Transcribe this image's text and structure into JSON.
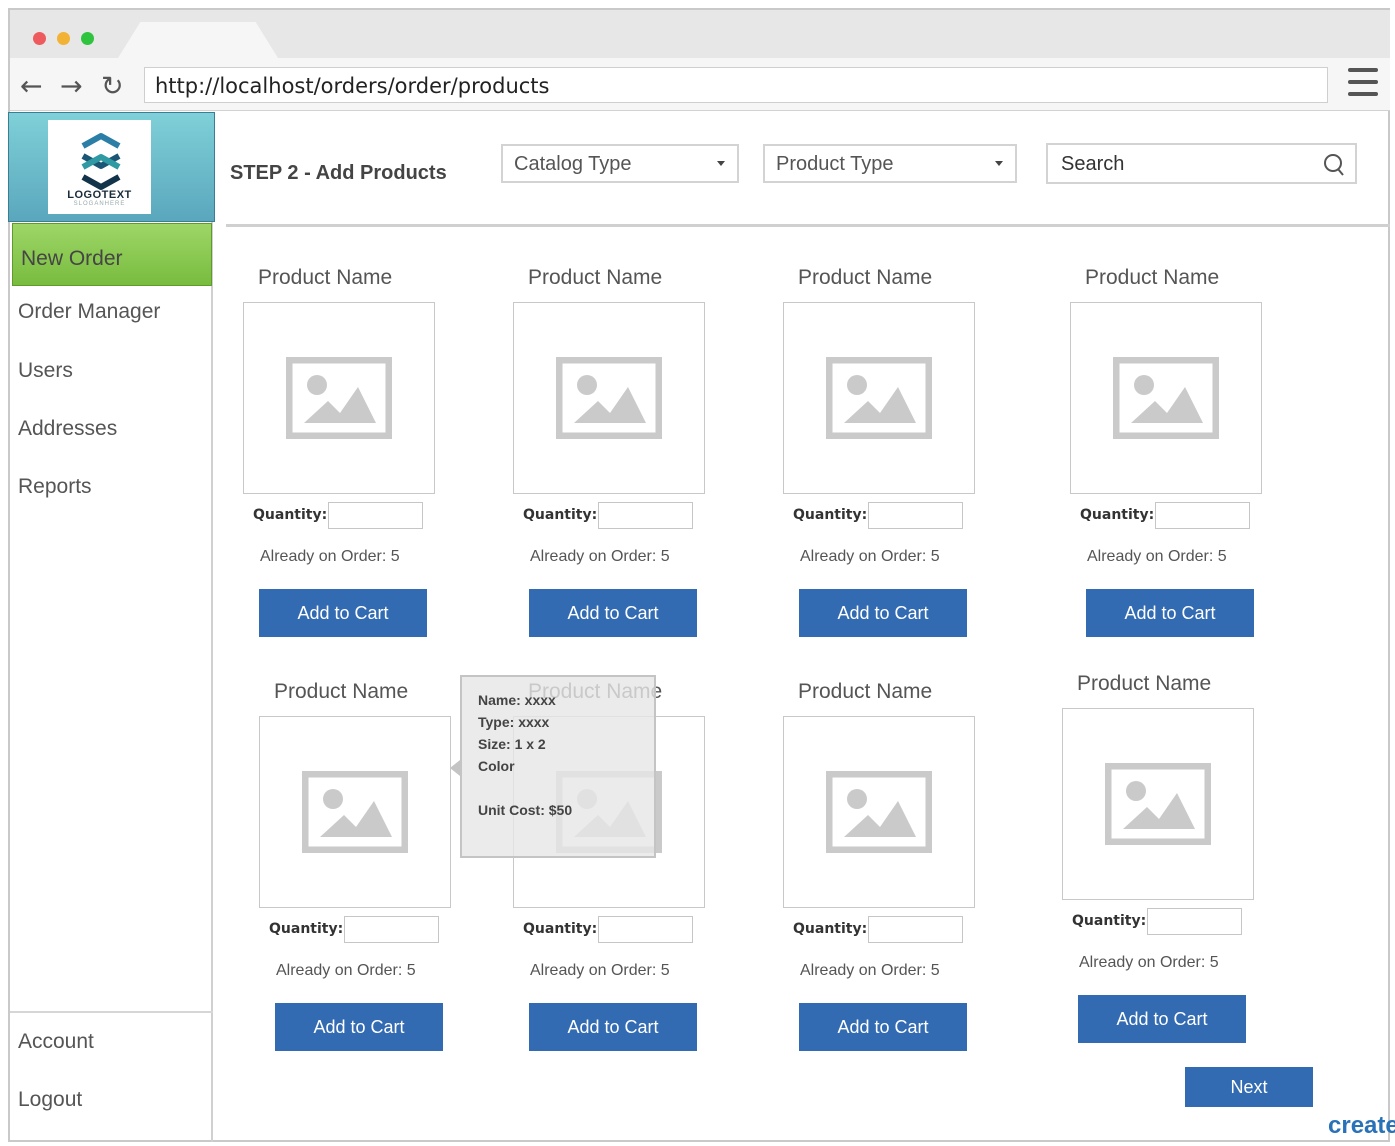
{
  "browser": {
    "url": "http://localhost/orders/order/products",
    "dot_colors": [
      "#ee5b5e",
      "#f2b233",
      "#2fc43e"
    ]
  },
  "logo": {
    "text": "LOGOTEXT",
    "slogan": "SLOGANHERE"
  },
  "sidebar": {
    "items": [
      {
        "label": "New Order",
        "active": true
      },
      {
        "label": "Order Manager"
      },
      {
        "label": "Users"
      },
      {
        "label": "Addresses"
      },
      {
        "label": "Reports"
      }
    ],
    "bottom_items": [
      {
        "label": "Account"
      },
      {
        "label": "Logout"
      }
    ]
  },
  "header": {
    "title": "STEP 2 - Add Products",
    "catalog_type": "Catalog Type",
    "product_type": "Product Type",
    "search_placeholder": "Search"
  },
  "products": [
    {
      "name": "Product Name",
      "quantity_label": "Quantity:",
      "already_label": "Already on Order:",
      "already_value": "5",
      "button": "Add to Cart"
    },
    {
      "name": "Product Name",
      "quantity_label": "Quantity:",
      "already_label": "Already on Order:",
      "already_value": "5",
      "button": "Add to Cart"
    },
    {
      "name": "Product Name",
      "quantity_label": "Quantity:",
      "already_label": "Already on Order:",
      "already_value": "5",
      "button": "Add to Cart"
    },
    {
      "name": "Product Name",
      "quantity_label": "Quantity:",
      "already_label": "Already on Order:",
      "already_value": "5",
      "button": "Add to Cart"
    },
    {
      "name": "Product Name",
      "quantity_label": "Quantity:",
      "already_label": "Already on Order:",
      "already_value": "5",
      "button": "Add to Cart"
    },
    {
      "name": "Product Name",
      "quantity_label": "Quantity:",
      "already_label": "Already on Order:",
      "already_value": "5",
      "button": "Add to Cart"
    },
    {
      "name": "Product Name",
      "quantity_label": "Quantity:",
      "already_label": "Already on Order:",
      "already_value": "5",
      "button": "Add to Cart"
    },
    {
      "name": "Product Name",
      "quantity_label": "Quantity:",
      "already_label": "Already on Order:",
      "already_value": "5",
      "button": "Add to Cart"
    }
  ],
  "tooltip": {
    "name": "Name: xxxx",
    "type": "Type: xxxx",
    "size": "Size: 1 x 2",
    "color": "Color",
    "unit_cost": "Unit Cost: $50"
  },
  "next_button": "Next",
  "watermark": "create",
  "colors": {
    "primary_button": "#336bb2",
    "active_nav": "#8bc953",
    "logo_bg": "#6cbccb"
  }
}
